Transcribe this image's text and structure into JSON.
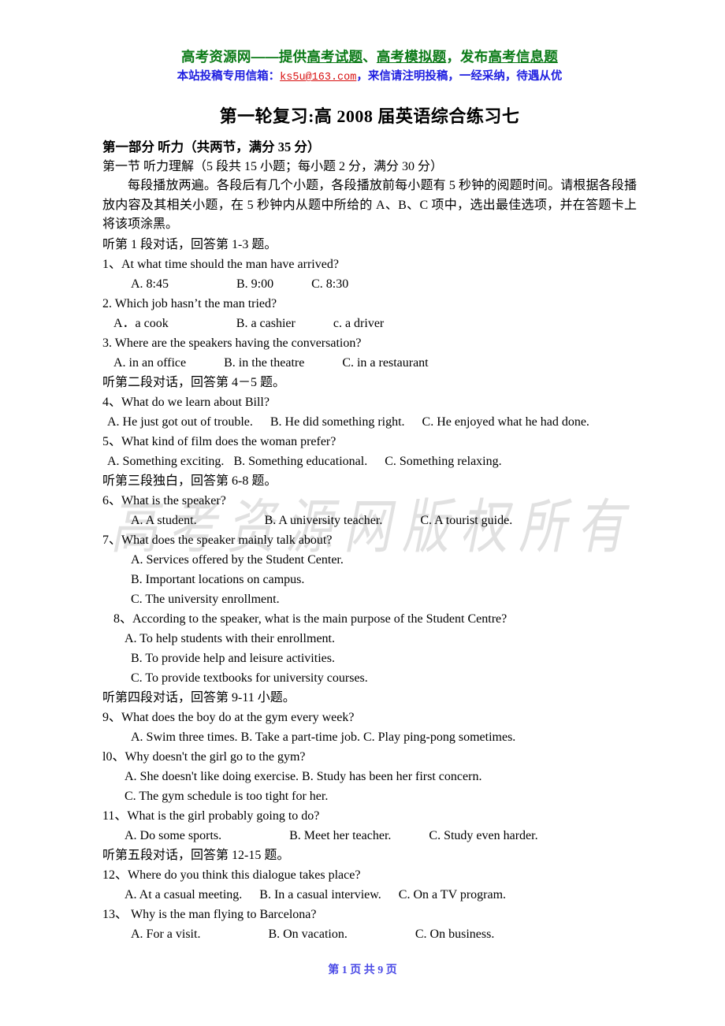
{
  "masthead": {
    "line1_pre": "高考资源网——提供",
    "line1_u1": "高考试题",
    "line1_mid1": "、",
    "line1_u2": "高考模拟题",
    "line1_mid2": "，发布",
    "line1_u3": "高考信息题",
    "line2_pre": "本站投稿专用信箱：",
    "email": "ks5u@163.com",
    "line2_post": "，来信请注明投稿，一经采纳，待遇从优"
  },
  "title": "第一轮复习:高 2008 届英语综合练习七",
  "section": {
    "part_heading": "第一部分 听力（共两节，满分 35 分）",
    "sub_heading": "第一节 听力理解（5 段共 15 小题；每小题 2 分，满分 30 分）",
    "instructions": "每段播放两遍。各段后有几个小题，各段播放前每小题有 5 秒钟的阅题时间。请根据各段播放内容及其相关小题，在 5 秒钟内从题中所给的 A、B、C 项中，选出最佳选项，并在答题卡上将该项涂黑。"
  },
  "cues": {
    "c1": "听第 1 段对话，回答第 1-3 题。",
    "c2": "听第二段对话，回答第 4－5 题。",
    "c3": "听第三段独白，回答第 6-8 题。",
    "c4": "听第四段对话，回答第 9-11 小题。",
    "c5": "听第五段对话，回答第 12-15 题。"
  },
  "questions": {
    "q1": {
      "stem": "1、At what time should the man have arrived?",
      "a": "A. 8:45",
      "b": "B. 9:00",
      "c": "C. 8:30"
    },
    "q2": {
      "stem": "2. Which job hasn’t the man tried?",
      "a": "A．a   cook",
      "b": "B. a cashier",
      "c": "c. a driver"
    },
    "q3": {
      "stem": "3. Where are the speakers having the conversation?",
      "a": "A. in an office",
      "b": "B. in the theatre",
      "c": "C. in a restaurant"
    },
    "q4": {
      "stem": "4、What do we learn about Bill?",
      "a": "A. He just got out of trouble.",
      "b": "B. He did something right.",
      "c": "C. He enjoyed what he had done."
    },
    "q5": {
      "stem": "5、What kind of film does the woman prefer?",
      "a": "A. Something exciting.",
      "b": "B. Something educational.",
      "c": "C. Something relaxing."
    },
    "q6": {
      "stem": "6、What is the speaker?",
      "a": "A. A student.",
      "b": "B. A university teacher.",
      "c": "C. A tourist guide."
    },
    "q7": {
      "stem": "7、What does the speaker mainly talk about?",
      "a": "A. Services offered by the Student Center.",
      "b": "B. Important locations on campus.",
      "c": "C. The university enrollment."
    },
    "q8": {
      "stem": "8、According to the speaker, what is the main purpose of the Student Centre?",
      "a": "A. To help students with their enrollment.",
      "b": "B. To provide help and leisure activities.",
      "c": "C. To provide textbooks for university courses."
    },
    "q9": {
      "stem": "9、What does the boy do at the gym every week?",
      "abc": "A. Swim three times. B. Take a part-time job. C. Play ping-pong sometimes."
    },
    "q10": {
      "stem": "l0、Why doesn't the girl go to the gym?",
      "ab": "A. She doesn't like doing exercise. B. Study has been her first concern.",
      "c": "C. The gym schedule is too tight for her."
    },
    "q11": {
      "stem": "11、What is the girl probably going to do?",
      "a": "A. Do some sports.",
      "b": "B. Meet her teacher.",
      "c": "C. Study even harder."
    },
    "q12": {
      "stem": "12、Where do you think this dialogue takes place?",
      "a": "A. At a casual meeting.",
      "b": "B. In a casual interview.",
      "c": "C. On a TV program."
    },
    "q13": {
      "stem": "13、  Why is the man flying to Barcelona?",
      "a": "A. For a visit.",
      "b": "B. On vacation.",
      "c": "C. On business."
    }
  },
  "watermark_text": "高考资源网版权所有",
  "footer": "第 1 页  共 9 页"
}
